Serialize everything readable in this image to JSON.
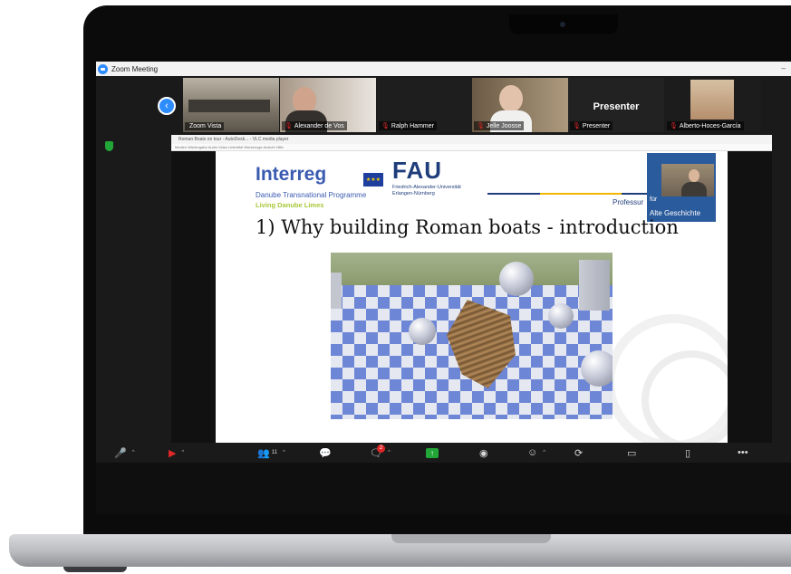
{
  "window": {
    "title": "Zoom Meeting"
  },
  "participants": [
    {
      "name": "Zoom Vista"
    },
    {
      "name": "Alexander de Vos"
    },
    {
      "name": "Ralph Hammer"
    },
    {
      "name": "Jelle Joosse"
    },
    {
      "name": "Presenter",
      "tile_label": "Presenter"
    },
    {
      "name": "Alberto-Hoces-García"
    }
  ],
  "shared_window": {
    "title": "Roman Boats on tour - AutoDesk... - VLC media player",
    "menu": "Medien  Wiedergabe  Audio  Video  Untertitel  Werkzeuge  Ansicht  Hilfe"
  },
  "slide": {
    "logo_interreg": "Interreg",
    "eu_flag": "★★★",
    "logo_danube": "Danube Transnational Programme",
    "logo_limes": "Living Danube Limes",
    "logo_fau": "FAU",
    "fau_line1": "Friedrich-Alexander-Universität",
    "fau_line2": "Erlangen-Nürnberg",
    "professur": "Professur",
    "badge_fuer": "für",
    "badge_alte": "Alte Geschichte",
    "title": "1) Why building Roman boats - introduction"
  },
  "toolbar": {
    "participants_count": "11",
    "chat_badge": "2"
  },
  "colors": {
    "zoom_blue": "#2d8cff",
    "share_green": "#23a638",
    "alert_red": "#e02828",
    "fau_navy": "#1f3d7a"
  },
  "icons": [
    "zoom-logo-icon",
    "chevron-left-icon",
    "shield-icon",
    "mute-mic-icon",
    "stop-video-icon",
    "participants-icon",
    "qa-icon",
    "chat-icon",
    "share-screen-icon",
    "record-icon",
    "reactions-icon",
    "apps-icon",
    "whiteboard-icon",
    "notes-icon",
    "more-icon"
  ]
}
